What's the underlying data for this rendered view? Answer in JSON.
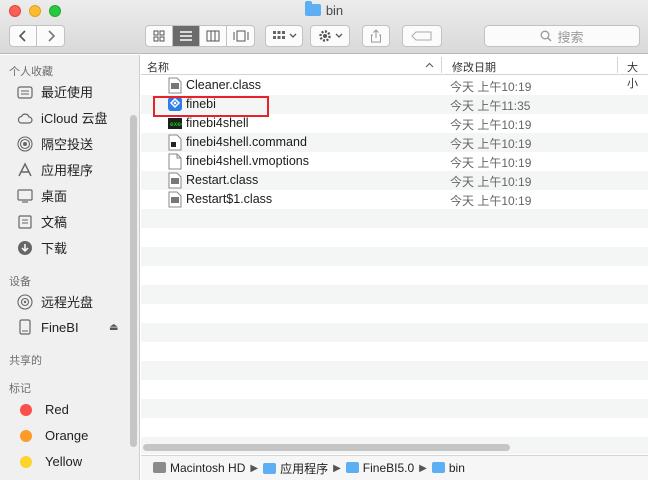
{
  "window": {
    "title": "bin"
  },
  "toolbar": {
    "search_placeholder": "搜索"
  },
  "sidebar": {
    "favorites_header": "个人收藏",
    "favorites": [
      {
        "label": "最近使用",
        "icon": "recents-icon"
      },
      {
        "label": "iCloud 云盘",
        "icon": "cloud-icon"
      },
      {
        "label": "隔空投送",
        "icon": "airdrop-icon"
      },
      {
        "label": "应用程序",
        "icon": "applications-icon"
      },
      {
        "label": "桌面",
        "icon": "desktop-icon"
      },
      {
        "label": "文稿",
        "icon": "documents-icon"
      },
      {
        "label": "下载",
        "icon": "downloads-icon"
      }
    ],
    "devices_header": "设备",
    "devices": [
      {
        "label": "远程光盘",
        "icon": "disc-icon"
      },
      {
        "label": "FineBI",
        "icon": "drive-icon"
      }
    ],
    "shared_header": "共享的",
    "tags_header": "标记",
    "tags": [
      {
        "label": "Red",
        "color": "#fc4e4a"
      },
      {
        "label": "Orange",
        "color": "#fd9a29"
      },
      {
        "label": "Yellow",
        "color": "#fdd42c"
      }
    ]
  },
  "columns": {
    "name": "名称",
    "modified": "修改日期",
    "size": "大小"
  },
  "files": [
    {
      "name": "Cleaner.class",
      "modified": "今天 上午10:19",
      "icon": "class-file-icon"
    },
    {
      "name": "finebi",
      "modified": "今天 上午11:35",
      "icon": "finebi-app-icon"
    },
    {
      "name": "finebi4shell",
      "modified": "今天 上午10:19",
      "icon": "terminal-exec-icon"
    },
    {
      "name": "finebi4shell.command",
      "modified": "今天 上午10:19",
      "icon": "command-file-icon"
    },
    {
      "name": "finebi4shell.vmoptions",
      "modified": "今天 上午10:19",
      "icon": "document-icon"
    },
    {
      "name": "Restart.class",
      "modified": "今天 上午10:19",
      "icon": "class-file-icon"
    },
    {
      "name": "Restart$1.class",
      "modified": "今天 上午10:19",
      "icon": "class-file-icon"
    }
  ],
  "pathbar": [
    "Macintosh HD",
    "应用程序",
    "FineBI5.0",
    "bin"
  ]
}
